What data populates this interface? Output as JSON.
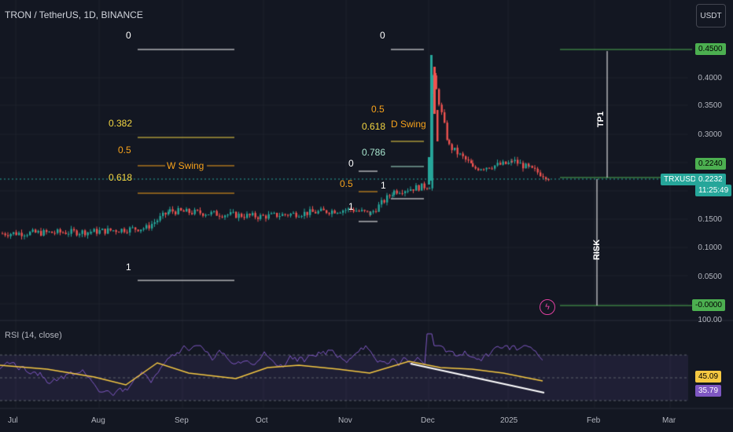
{
  "header": {
    "symbol_title": "TRON / TetherUS, 1D, BINANCE",
    "currency_button": "USDT"
  },
  "rsi": {
    "title": "RSI (14, close)",
    "value_yellow": "45.09",
    "value_purple": "35.79",
    "top_label": "100.00"
  },
  "price_axis": [
    "0.4000",
    "0.3500",
    "0.3000",
    "0.2000",
    "0.1500",
    "0.1000",
    "0.0500"
  ],
  "time_axis": [
    "Jul",
    "Aug",
    "Sep",
    "Oct",
    "Nov",
    "Dec",
    "2025",
    "Feb",
    "Mar"
  ],
  "tags": {
    "tp": "0.4500",
    "entry": "0.2240",
    "symbol": "TRXUSDT",
    "last_price": "0.2232",
    "countdown": "11:25:49",
    "risk_zero": "-0.0000"
  },
  "annotations": {
    "tp1": "TP1",
    "risk": "RISK",
    "w_swing": "W Swing",
    "d_swing": "D Swing"
  },
  "fib_w": {
    "l0": "0",
    "l382": "0.382",
    "l5": "0.5",
    "l618": "0.618",
    "l1": "1"
  },
  "fib_d": {
    "l0": "0",
    "l5": "0.5",
    "l618": "0.618",
    "l786": "0.786"
  },
  "fib_small": {
    "l0": "0",
    "l5": "0.5",
    "l1a": "1",
    "l1b": "1"
  },
  "colors": {
    "bg": "#131722",
    "up": "#26a69a",
    "down": "#ef5350",
    "green_line": "#4caf50",
    "rsi_line": "#7e57c2",
    "ma_line": "#f5c842"
  },
  "chart_data": {
    "type": "candlestick",
    "symbol": "TRXUSDT",
    "ylim": [
      -0.02,
      0.47
    ],
    "price_levels": {
      "take_profit": 0.45,
      "entry": 0.224,
      "stop": 0.0
    },
    "closes_approx": [
      {
        "x": "Jul",
        "y": 0.125
      },
      {
        "x": "Aug",
        "y": 0.13
      },
      {
        "x": "mid-Aug",
        "y": 0.16
      },
      {
        "x": "Sep",
        "y": 0.155
      },
      {
        "x": "Oct",
        "y": 0.157
      },
      {
        "x": "Nov",
        "y": 0.165
      },
      {
        "x": "mid-Nov",
        "y": 0.2
      },
      {
        "x": "late-Nov",
        "y": 0.21
      },
      {
        "x": "Dec",
        "y": 0.44
      },
      {
        "x": "mid-Dec",
        "y": 0.27
      },
      {
        "x": "2025",
        "y": 0.25
      },
      {
        "x": "mid-Jan",
        "y": 0.223
      }
    ],
    "rsi": {
      "period": 14,
      "last": 35.79,
      "ma_last": 45.09
    }
  }
}
